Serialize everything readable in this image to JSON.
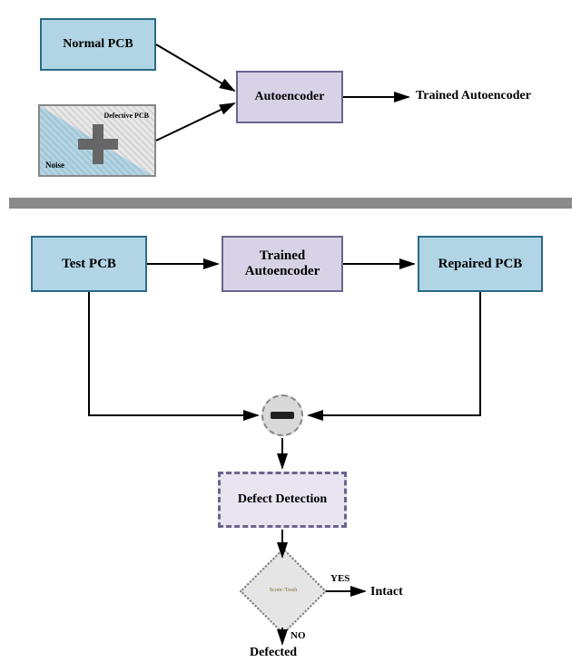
{
  "top": {
    "normal_pcb": "Normal PCB",
    "defective_pcb": "Defective PCB",
    "noise": "Noise",
    "autoencoder": "Autoencoder",
    "trained_autoencoder_out": "Trained Autoencoder"
  },
  "bottom": {
    "test_pcb": "Test PCB",
    "trained_autoencoder": "Trained\nAutoencoder",
    "repaired_pcb": "Repaired PCB",
    "defect_detection": "Defect Detection",
    "decision": "Score>Tresh",
    "yes": "YES",
    "no": "NO",
    "intact": "Intact",
    "defected": "Defected"
  },
  "colors": {
    "blue_fill": "#b1d5e5",
    "blue_border": "#2a6a86",
    "purple_fill": "#d8d2e6",
    "purple_border": "#6b648e",
    "separator": "#8a8a8a"
  }
}
